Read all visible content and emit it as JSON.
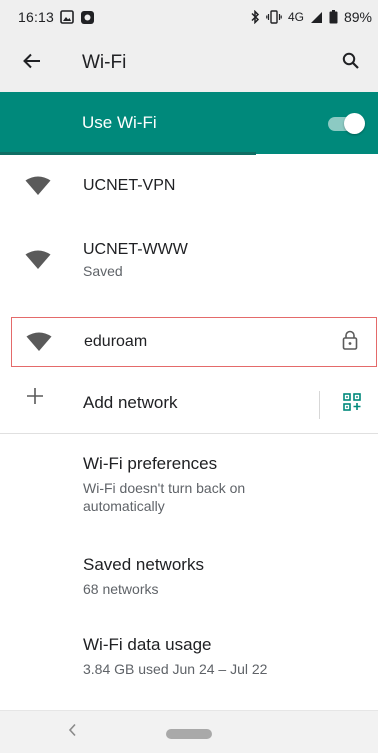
{
  "status_bar": {
    "time": "16:13",
    "network": "4G",
    "battery": "89%"
  },
  "app_bar": {
    "title": "Wi-Fi"
  },
  "wifi_toggle": {
    "label": "Use Wi-Fi",
    "state": "on",
    "accent_color": "#00897b"
  },
  "networks": [
    {
      "name": "UCNET-VPN",
      "status": "",
      "secured": false
    },
    {
      "name": "UCNET-WWW",
      "status": "Saved",
      "secured": false
    },
    {
      "name": "eduroam",
      "status": "",
      "secured": true
    }
  ],
  "add_network": {
    "label": "Add network"
  },
  "preferences": [
    {
      "title": "Wi-Fi preferences",
      "subtitle": "Wi-Fi doesn't turn back on automatically"
    },
    {
      "title": "Saved networks",
      "subtitle": "68 networks"
    },
    {
      "title": "Wi-Fi data usage",
      "subtitle": "3.84 GB used Jun 24 – Jul 22"
    }
  ],
  "icons": {
    "back": "arrow-left-icon",
    "search": "search-icon",
    "wifi": "wifi-icon",
    "lock": "lock-icon",
    "add": "plus-icon",
    "qr": "qr-code-icon",
    "nav_back": "chevron-left-icon",
    "nav_home": "home-pill-icon"
  }
}
